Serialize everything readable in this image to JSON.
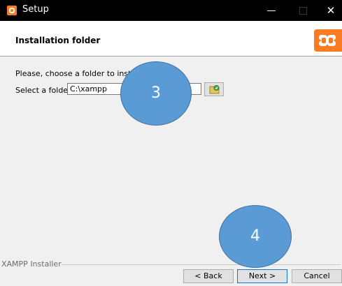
{
  "window": {
    "title": "Setup",
    "app_icon": "xampp-icon",
    "controls": {
      "minimize_icon": "minimize-icon",
      "maximize_icon": "maximize-icon",
      "close_label": "✕"
    }
  },
  "header": {
    "title": "Installation folder",
    "logo": "xampp-logo"
  },
  "content": {
    "prompt": "Please, choose a folder to install X",
    "folder_label": "Select a folder",
    "folder_value": "C:\\xampp",
    "browse_icon": "folder-browse-icon"
  },
  "footer": {
    "group_label": "XAMPP Installer",
    "back_label": "< Back",
    "next_label": "Next >",
    "cancel_label": "Cancel"
  },
  "annotations": {
    "marker_3": "3",
    "marker_4": "4"
  },
  "colors": {
    "titlebar": "#000000",
    "brand_orange": "#fb7a24",
    "marker_fill": "#5b9bd5",
    "marker_border": "#41719c",
    "focus_border": "#0078d7"
  }
}
